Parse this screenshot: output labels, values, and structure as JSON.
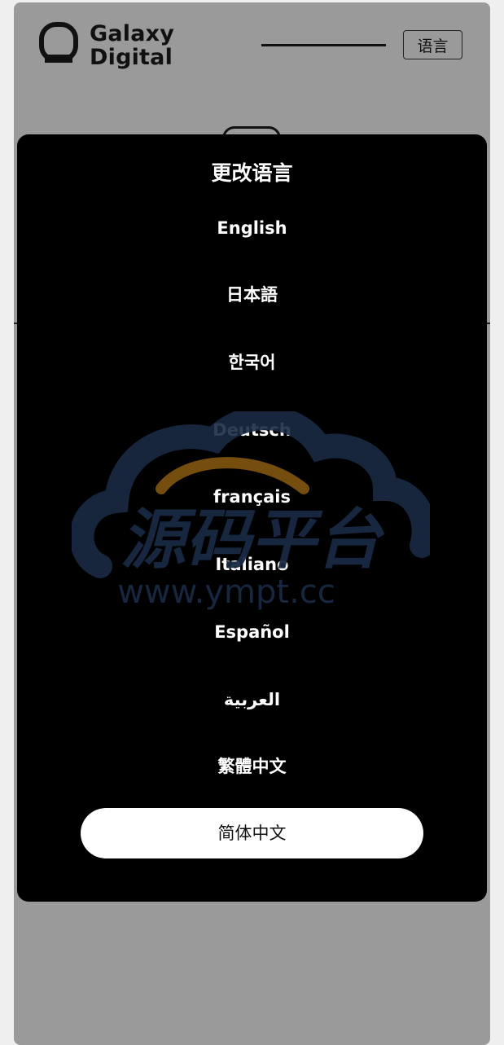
{
  "header": {
    "logo_line1": "Galaxy",
    "logo_line2": "Digital",
    "language_button": "语言"
  },
  "modal": {
    "title": "更改语言",
    "languages": [
      "English",
      "日本語",
      "한국어",
      "Deutsch",
      "français",
      "Italiano",
      "Español",
      "العربية",
      "繁體中文"
    ],
    "selected_language": "简体中文"
  },
  "watermark": {
    "title": "源码平台",
    "url": "www.ympt.cc"
  },
  "colors": {
    "overlay": "#9a9a9a",
    "modal_bg": "#000000",
    "selected_bg": "#ffffff",
    "text_light": "#ffffff",
    "text_dark": "#111111",
    "watermark_blue": "#1a2a44",
    "watermark_orange": "#8a5a12"
  }
}
